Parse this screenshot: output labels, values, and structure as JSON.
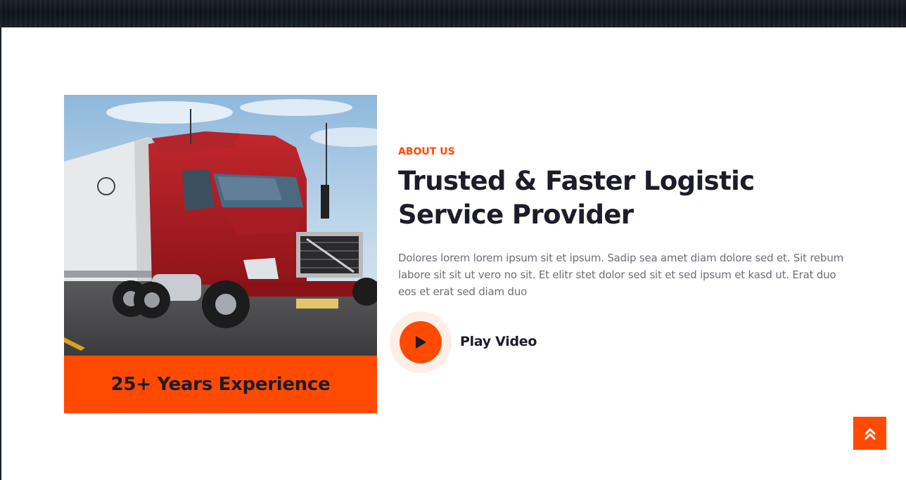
{
  "about": {
    "label": "ABOUT US",
    "heading_line1": "Trusted & Faster Logistic",
    "heading_line2": "Service Provider",
    "description": "Dolores lorem lorem ipsum sit et ipsum. Sadip sea amet diam dolore sed et. Sit rebum labore sit sit ut vero no sit. Et elitr stet dolor sed sit et sed ipsum et kasd ut. Erat duo eos et erat sed diam duo"
  },
  "experience": {
    "text": "25+ Years Experience"
  },
  "video": {
    "label": "Play Video",
    "icon": "play-icon"
  },
  "scroll_top": {
    "icon": "double-chevron-up-icon"
  },
  "colors": {
    "accent": "#ff4a00",
    "heading": "#1d1c2a",
    "body_text": "#6f6e78",
    "play_halo": "#fdeee7"
  }
}
